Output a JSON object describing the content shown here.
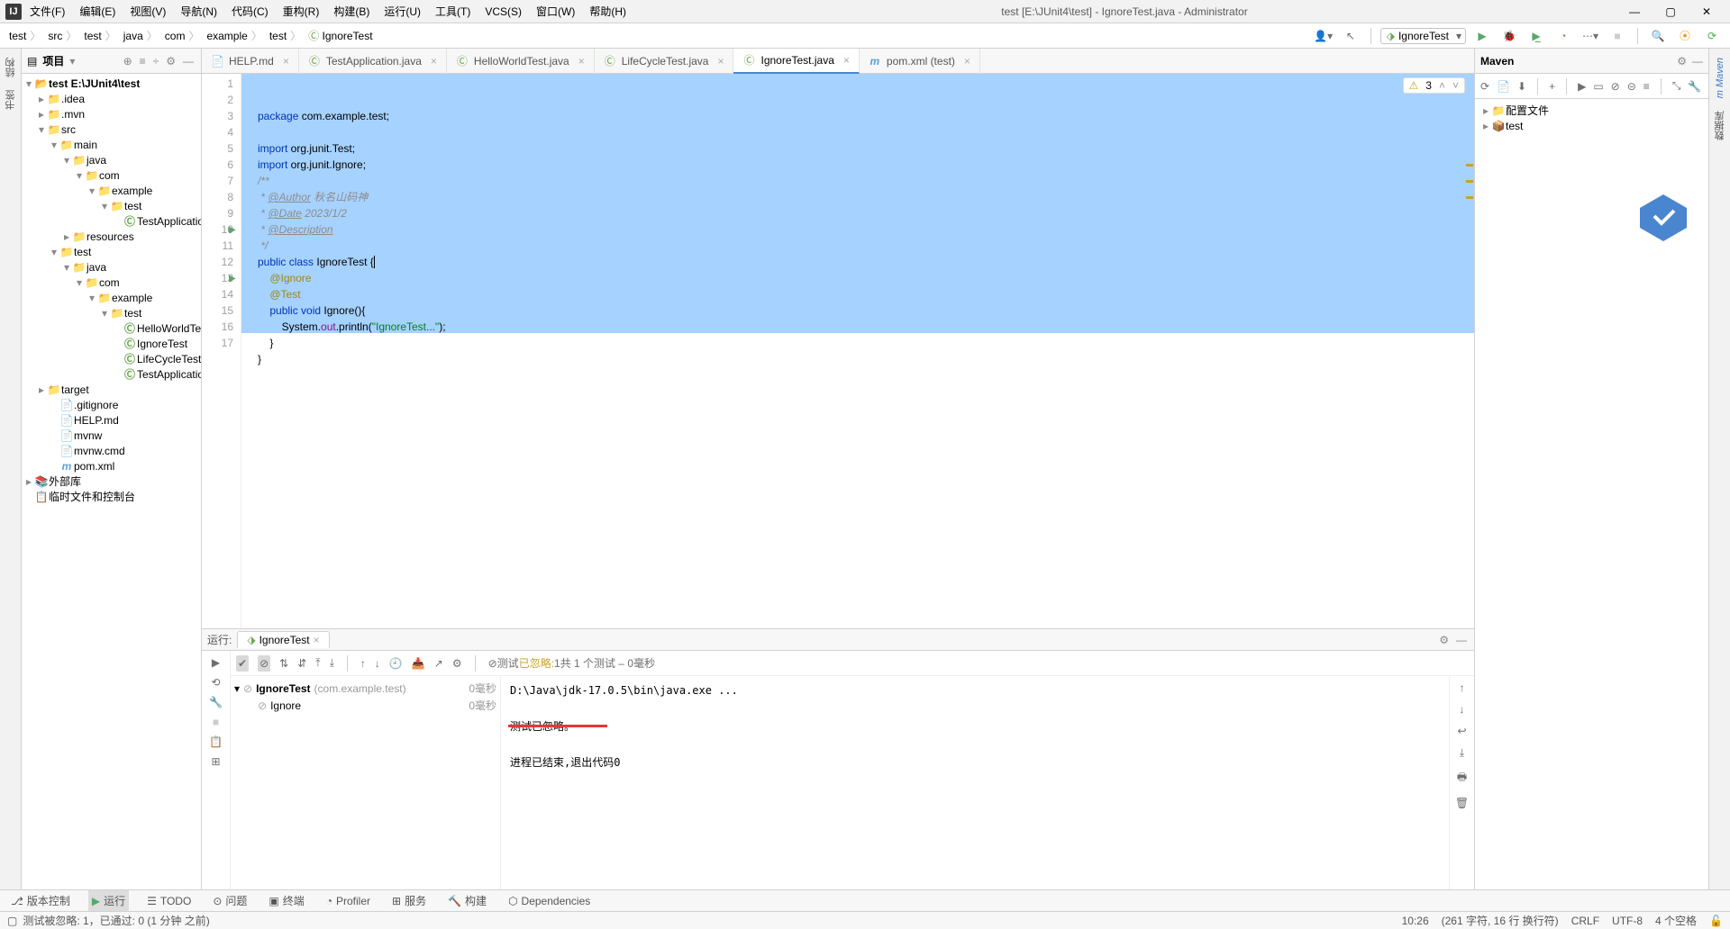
{
  "title": "test [E:\\JUnit4\\test] - IgnoreTest.java - Administrator",
  "menu": [
    "文件(F)",
    "编辑(E)",
    "视图(V)",
    "导航(N)",
    "代码(C)",
    "重构(R)",
    "构建(B)",
    "运行(U)",
    "工具(T)",
    "VCS(S)",
    "窗口(W)",
    "帮助(H)"
  ],
  "breadcrumbs": [
    "test",
    "src",
    "test",
    "java",
    "com",
    "example",
    "test",
    "IgnoreTest"
  ],
  "run_config": "IgnoreTest",
  "project_panel": {
    "title": "项目",
    "tree": {
      "root": "test E:\\JUnit4\\test",
      "idea": ".idea",
      "mvn": ".mvn",
      "src": "src",
      "main": "main",
      "java1": "java",
      "com1": "com",
      "example1": "example",
      "test1": "test",
      "testapp": "TestApplication",
      "resources": "resources",
      "test_dir": "test",
      "java2": "java",
      "com2": "com",
      "example2": "example",
      "test2": "test",
      "hello": "HelloWorldTest",
      "ignore": "IgnoreTest",
      "life": "LifeCycleTest",
      "testappt": "TestApplicationT",
      "target": "target",
      "gitignore": ".gitignore",
      "help": "HELP.md",
      "mvnw": "mvnw",
      "mvnwcmd": "mvnw.cmd",
      "pom": "pom.xml",
      "ext": "外部库",
      "scratch": "临时文件和控制台"
    }
  },
  "tabs": [
    {
      "icon": "md",
      "label": "HELP.md",
      "active": false
    },
    {
      "icon": "java",
      "label": "TestApplication.java",
      "active": false
    },
    {
      "icon": "java",
      "label": "HelloWorldTest.java",
      "active": false
    },
    {
      "icon": "java",
      "label": "LifeCycleTest.java",
      "active": false
    },
    {
      "icon": "java",
      "label": "IgnoreTest.java",
      "active": true
    },
    {
      "icon": "xml",
      "label": "pom.xml (test)",
      "active": false
    }
  ],
  "editor": {
    "warn_count": "3",
    "code_lines": [
      "package com.example.test;",
      "",
      "import org.junit.Test;",
      "import org.junit.Ignore;",
      "/**",
      " * @Author 秋名山码神",
      " * @Date 2023/1/2",
      " * @Description",
      " */",
      "public class IgnoreTest {",
      "    @Ignore",
      "    @Test",
      "    public void Ignore(){",
      "        System.out.println(\"IgnoreTest...\");",
      "    }",
      "}",
      ""
    ]
  },
  "maven": {
    "title": "Maven",
    "profiles": "配置文件",
    "module": "test"
  },
  "run": {
    "tab_label": "运行:",
    "tab_name": "IgnoreTest",
    "status_prefix": "测试 ",
    "status_skip": "已忽略:",
    "status_detail": " 1共 1 个测试 – 0毫秒",
    "tree_root": "IgnoreTest",
    "tree_root_pkg": "(com.example.test)",
    "tree_root_dur": "0毫秒",
    "tree_child": "Ignore",
    "tree_child_dur": "0毫秒",
    "console": [
      "D:\\Java\\jdk-17.0.5\\bin\\java.exe ...",
      "",
      "测试已忽略。",
      "",
      "进程已结束,退出代码0"
    ]
  },
  "bottom_tabs": {
    "vcs": "版本控制",
    "run": "运行",
    "todo": "TODO",
    "problems": "问题",
    "terminal": "终端",
    "profiler": "Profiler",
    "services": "服务",
    "build": "构建",
    "deps": "Dependencies"
  },
  "status_left": "测试被忽略: 1，已通过: 0 (1 分钟 之前)",
  "status_right": {
    "pos": "10:26",
    "chars": "(261 字符, 16 行 换行符)",
    "crlf": "CRLF",
    "enc": "UTF-8",
    "indent": "4 个空格"
  }
}
